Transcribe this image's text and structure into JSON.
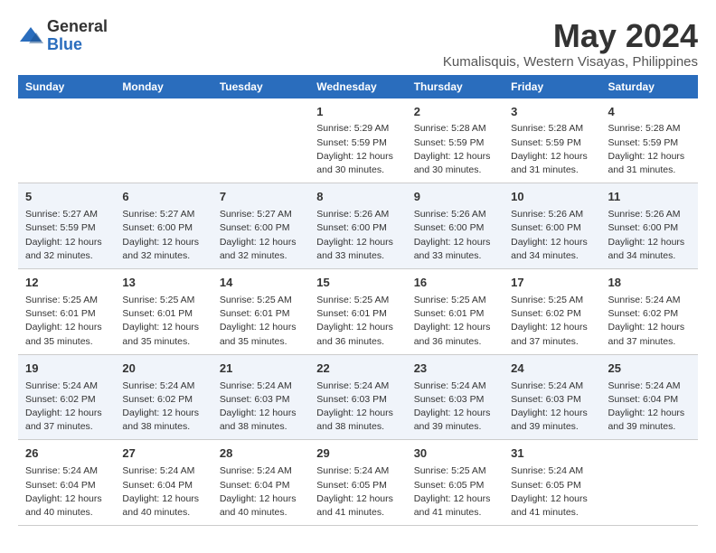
{
  "logo": {
    "general": "General",
    "blue": "Blue"
  },
  "header": {
    "month": "May 2024",
    "location": "Kumalisquis, Western Visayas, Philippines"
  },
  "weekdays": [
    "Sunday",
    "Monday",
    "Tuesday",
    "Wednesday",
    "Thursday",
    "Friday",
    "Saturday"
  ],
  "weeks": [
    [
      {
        "day": "",
        "info": ""
      },
      {
        "day": "",
        "info": ""
      },
      {
        "day": "",
        "info": ""
      },
      {
        "day": "1",
        "info": "Sunrise: 5:29 AM\nSunset: 5:59 PM\nDaylight: 12 hours and 30 minutes."
      },
      {
        "day": "2",
        "info": "Sunrise: 5:28 AM\nSunset: 5:59 PM\nDaylight: 12 hours and 30 minutes."
      },
      {
        "day": "3",
        "info": "Sunrise: 5:28 AM\nSunset: 5:59 PM\nDaylight: 12 hours and 31 minutes."
      },
      {
        "day": "4",
        "info": "Sunrise: 5:28 AM\nSunset: 5:59 PM\nDaylight: 12 hours and 31 minutes."
      }
    ],
    [
      {
        "day": "5",
        "info": "Sunrise: 5:27 AM\nSunset: 5:59 PM\nDaylight: 12 hours and 32 minutes."
      },
      {
        "day": "6",
        "info": "Sunrise: 5:27 AM\nSunset: 6:00 PM\nDaylight: 12 hours and 32 minutes."
      },
      {
        "day": "7",
        "info": "Sunrise: 5:27 AM\nSunset: 6:00 PM\nDaylight: 12 hours and 32 minutes."
      },
      {
        "day": "8",
        "info": "Sunrise: 5:26 AM\nSunset: 6:00 PM\nDaylight: 12 hours and 33 minutes."
      },
      {
        "day": "9",
        "info": "Sunrise: 5:26 AM\nSunset: 6:00 PM\nDaylight: 12 hours and 33 minutes."
      },
      {
        "day": "10",
        "info": "Sunrise: 5:26 AM\nSunset: 6:00 PM\nDaylight: 12 hours and 34 minutes."
      },
      {
        "day": "11",
        "info": "Sunrise: 5:26 AM\nSunset: 6:00 PM\nDaylight: 12 hours and 34 minutes."
      }
    ],
    [
      {
        "day": "12",
        "info": "Sunrise: 5:25 AM\nSunset: 6:01 PM\nDaylight: 12 hours and 35 minutes."
      },
      {
        "day": "13",
        "info": "Sunrise: 5:25 AM\nSunset: 6:01 PM\nDaylight: 12 hours and 35 minutes."
      },
      {
        "day": "14",
        "info": "Sunrise: 5:25 AM\nSunset: 6:01 PM\nDaylight: 12 hours and 35 minutes."
      },
      {
        "day": "15",
        "info": "Sunrise: 5:25 AM\nSunset: 6:01 PM\nDaylight: 12 hours and 36 minutes."
      },
      {
        "day": "16",
        "info": "Sunrise: 5:25 AM\nSunset: 6:01 PM\nDaylight: 12 hours and 36 minutes."
      },
      {
        "day": "17",
        "info": "Sunrise: 5:25 AM\nSunset: 6:02 PM\nDaylight: 12 hours and 37 minutes."
      },
      {
        "day": "18",
        "info": "Sunrise: 5:24 AM\nSunset: 6:02 PM\nDaylight: 12 hours and 37 minutes."
      }
    ],
    [
      {
        "day": "19",
        "info": "Sunrise: 5:24 AM\nSunset: 6:02 PM\nDaylight: 12 hours and 37 minutes."
      },
      {
        "day": "20",
        "info": "Sunrise: 5:24 AM\nSunset: 6:02 PM\nDaylight: 12 hours and 38 minutes."
      },
      {
        "day": "21",
        "info": "Sunrise: 5:24 AM\nSunset: 6:03 PM\nDaylight: 12 hours and 38 minutes."
      },
      {
        "day": "22",
        "info": "Sunrise: 5:24 AM\nSunset: 6:03 PM\nDaylight: 12 hours and 38 minutes."
      },
      {
        "day": "23",
        "info": "Sunrise: 5:24 AM\nSunset: 6:03 PM\nDaylight: 12 hours and 39 minutes."
      },
      {
        "day": "24",
        "info": "Sunrise: 5:24 AM\nSunset: 6:03 PM\nDaylight: 12 hours and 39 minutes."
      },
      {
        "day": "25",
        "info": "Sunrise: 5:24 AM\nSunset: 6:04 PM\nDaylight: 12 hours and 39 minutes."
      }
    ],
    [
      {
        "day": "26",
        "info": "Sunrise: 5:24 AM\nSunset: 6:04 PM\nDaylight: 12 hours and 40 minutes."
      },
      {
        "day": "27",
        "info": "Sunrise: 5:24 AM\nSunset: 6:04 PM\nDaylight: 12 hours and 40 minutes."
      },
      {
        "day": "28",
        "info": "Sunrise: 5:24 AM\nSunset: 6:04 PM\nDaylight: 12 hours and 40 minutes."
      },
      {
        "day": "29",
        "info": "Sunrise: 5:24 AM\nSunset: 6:05 PM\nDaylight: 12 hours and 41 minutes."
      },
      {
        "day": "30",
        "info": "Sunrise: 5:25 AM\nSunset: 6:05 PM\nDaylight: 12 hours and 41 minutes."
      },
      {
        "day": "31",
        "info": "Sunrise: 5:24 AM\nSunset: 6:05 PM\nDaylight: 12 hours and 41 minutes."
      },
      {
        "day": "",
        "info": ""
      }
    ]
  ]
}
